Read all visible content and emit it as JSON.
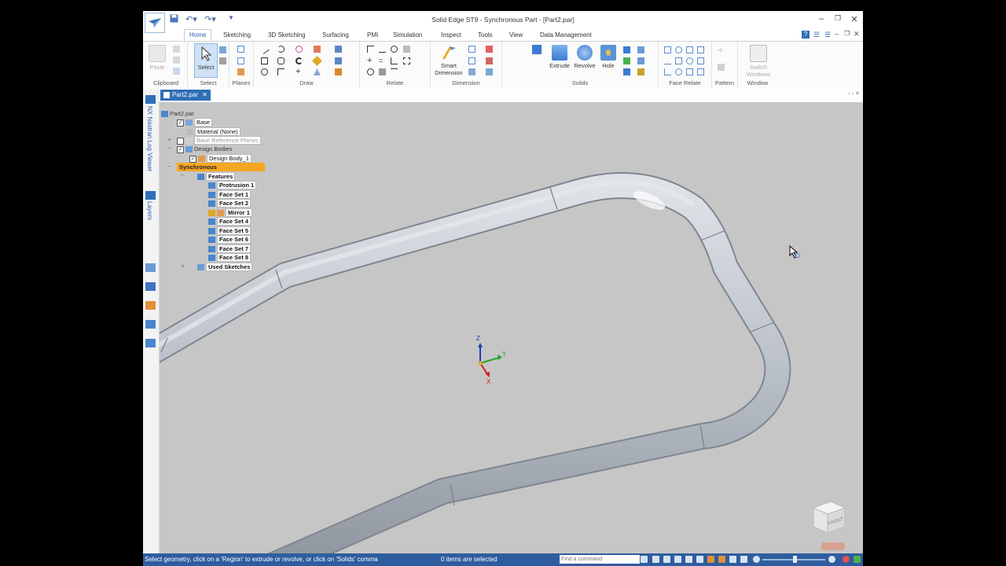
{
  "window": {
    "title": "Solid Edge ST9 - Synchronous Part - [Part2.par]",
    "controls": {
      "minimize": "–",
      "restore": "▫",
      "close": "✕"
    }
  },
  "tabs": [
    "Home",
    "Sketching",
    "3D Sketching",
    "Surfacing",
    "PMI",
    "Simulation",
    "Inspect",
    "Tools",
    "View",
    "Data Management"
  ],
  "active_tab": "Home",
  "ribbon": {
    "groups": [
      {
        "label": "Clipboard",
        "buttons": [
          "Paste"
        ]
      },
      {
        "label": "Select",
        "buttons": [
          "Select"
        ]
      },
      {
        "label": "Planes",
        "buttons": []
      },
      {
        "label": "Draw",
        "buttons": []
      },
      {
        "label": "Relate",
        "buttons": []
      },
      {
        "label": "Dimension",
        "buttons": [
          "Smart",
          "Dimension"
        ]
      },
      {
        "label": "Solids",
        "buttons": [
          "Extrude",
          "Revolve",
          "Hole"
        ]
      },
      {
        "label": "Face Relate",
        "buttons": []
      },
      {
        "label": "Pattern",
        "buttons": []
      },
      {
        "label": "Window",
        "buttons": [
          "Switch",
          "Windows"
        ]
      }
    ]
  },
  "document_tab": {
    "label": "Part2.par",
    "close": "✕"
  },
  "left_panel": {
    "nastran": "NX Nastran Log Viewer",
    "layers": "Layers"
  },
  "tree": {
    "root": "Part2.par",
    "nodes": [
      {
        "label": "Base"
      },
      {
        "label": "Material (None)"
      },
      {
        "label": "Base Reference Planes"
      },
      {
        "label": "Design Bodies"
      },
      {
        "label": "Design Body_1"
      },
      {
        "label": "Synchronous"
      },
      {
        "label": "Features"
      },
      {
        "label": "Protrusion 1"
      },
      {
        "label": "Face Set 1"
      },
      {
        "label": "Face Set 2"
      },
      {
        "label": "Mirror 1"
      },
      {
        "label": "Face Set 4"
      },
      {
        "label": "Face Set 5"
      },
      {
        "label": "Face Set 6"
      },
      {
        "label": "Face Set 7"
      },
      {
        "label": "Face Set 8"
      },
      {
        "label": "Used Sketches"
      }
    ]
  },
  "triad": {
    "z": "Z",
    "y": "Y",
    "x": "X"
  },
  "view_cube": {
    "face": "FRONT"
  },
  "status_bar": {
    "message": "Select geometry, click on a 'Region' to extrude or revolve, or click on 'Solids' comma",
    "selection": "0 items are selected",
    "command_placeholder": "Find a command"
  },
  "colors": {
    "accent": "#2f6fb6",
    "viewport": "#c6c6c6",
    "tube": "#b9c0ca",
    "synchronous_highlight": "#f5a623"
  }
}
